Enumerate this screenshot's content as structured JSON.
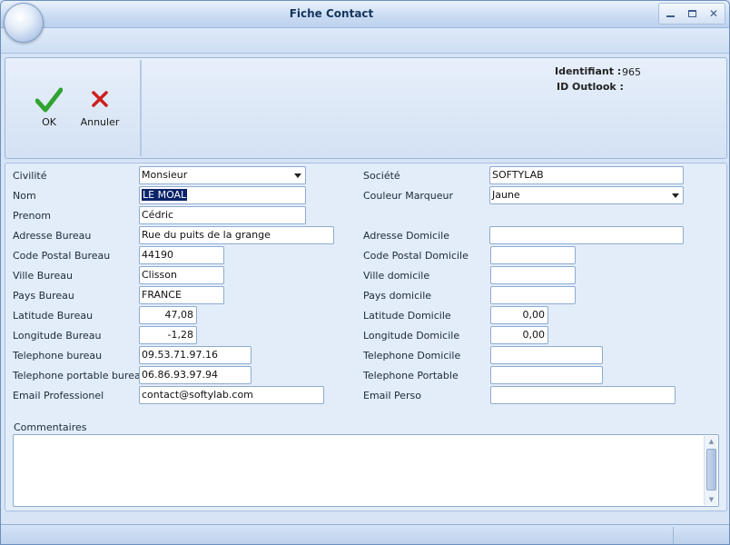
{
  "window": {
    "title": "Fiche Contact"
  },
  "toolbar": {
    "ok_label": "OK",
    "cancel_label": "Annuler"
  },
  "info": {
    "identifiant_label": "Identifiant :",
    "identifiant_value": "965",
    "outlook_label": "ID Outlook :",
    "outlook_value": ""
  },
  "form": {
    "civilite": {
      "label": "Civilité",
      "value": "Monsieur"
    },
    "nom": {
      "label": "Nom",
      "value": "LE MOAL"
    },
    "prenom": {
      "label": "Prenom",
      "value": "Cédric"
    },
    "adresse_bureau": {
      "label": "Adresse Bureau",
      "value": "Rue du puits de la grange"
    },
    "cp_bureau": {
      "label": "Code Postal Bureau",
      "value": "44190"
    },
    "ville_bureau": {
      "label": "Ville Bureau",
      "value": "Clisson"
    },
    "pays_bureau": {
      "label": "Pays Bureau",
      "value": "FRANCE"
    },
    "lat_bureau": {
      "label": "Latitude Bureau",
      "value": "47,08"
    },
    "lon_bureau": {
      "label": "Longitude Bureau",
      "value": "-1,28"
    },
    "tel_bureau": {
      "label": "Telephone bureau",
      "value": "09.53.71.97.16"
    },
    "mobile_bureau": {
      "label": "Telephone portable bureau",
      "value": "06.86.93.97.94"
    },
    "email_pro": {
      "label": "Email Professionel",
      "value": "contact@softylab.com"
    },
    "societe": {
      "label": "Société",
      "value": "SOFTYLAB"
    },
    "couleur": {
      "label": "Couleur Marqueur",
      "value": "Jaune"
    },
    "adresse_dom": {
      "label": "Adresse Domicile",
      "value": ""
    },
    "cp_dom": {
      "label": "Code Postal Domicile",
      "value": ""
    },
    "ville_dom": {
      "label": "Ville domicile",
      "value": ""
    },
    "pays_dom": {
      "label": "Pays domicile",
      "value": ""
    },
    "lat_dom": {
      "label": "Latitude Domicile",
      "value": "0,00"
    },
    "lon_dom": {
      "label": "Longitude Domicile",
      "value": "0,00"
    },
    "tel_dom": {
      "label": "Telephone Domicile",
      "value": ""
    },
    "mobile_dom": {
      "label": "Telephone Portable",
      "value": ""
    },
    "email_perso": {
      "label": "Email Perso",
      "value": ""
    },
    "commentaires": {
      "label": "Commentaires",
      "value": ""
    }
  },
  "colors": {
    "accent": "#0a246a",
    "ok": "#2fa32f",
    "cancel": "#cc1f1f"
  },
  "icons": {
    "ok": "checkmark-icon",
    "cancel": "x-icon"
  }
}
